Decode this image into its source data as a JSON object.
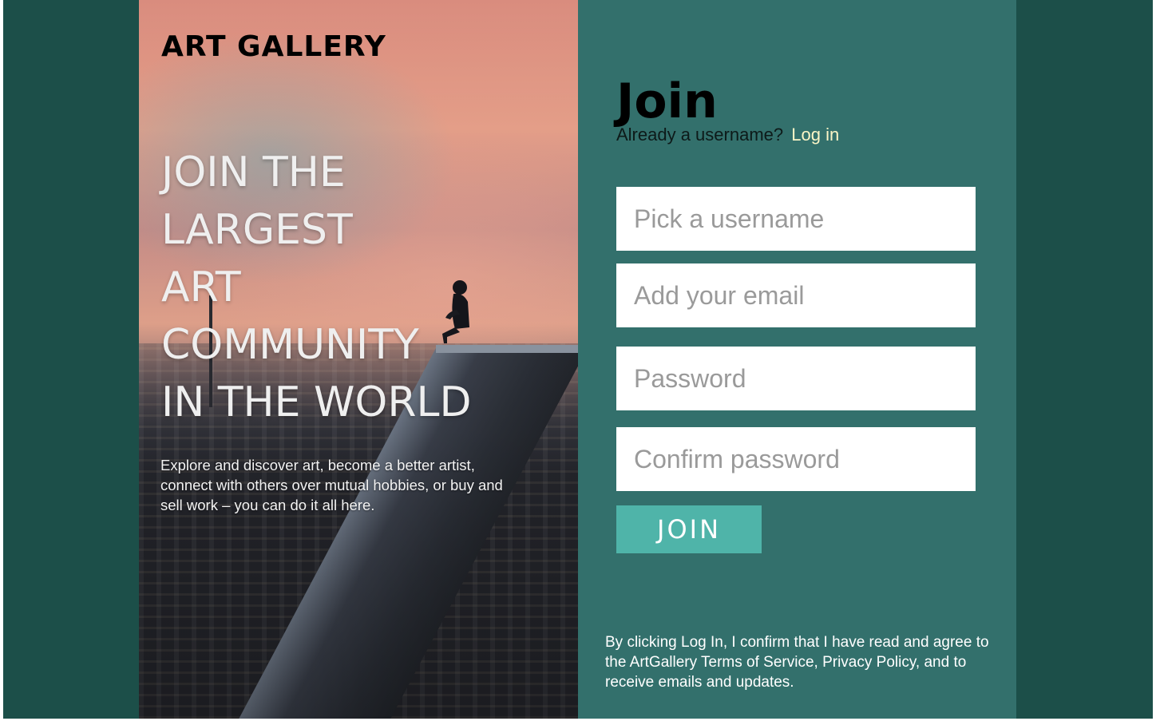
{
  "brand": {
    "title": "ART GALLERY"
  },
  "hero": {
    "headline_lines": [
      "JOIN THE",
      "LARGEST",
      "ART",
      "COMMUNITY",
      "IN THE WORLD"
    ],
    "description": "Explore and discover art, become a better artist, connect with others over mutual hobbies, or buy and sell work – you can do it all here."
  },
  "form": {
    "title": "Join",
    "already_text": "Already a username?",
    "login_link": "Log in",
    "username_placeholder": "Pick a username",
    "email_placeholder": "Add your email",
    "password_placeholder": "Password",
    "confirm_placeholder": "Confirm password",
    "submit_label": "JOIN",
    "terms": "By clicking Log In, I confirm that I have read and agree to the ArtGallery Terms of Service, Privacy Policy, and to receive emails and updates."
  },
  "colors": {
    "outer_background": "#1c4f49",
    "form_panel": "#33706c",
    "button": "#4fb4a9",
    "login_link": "#fbf5c6"
  }
}
